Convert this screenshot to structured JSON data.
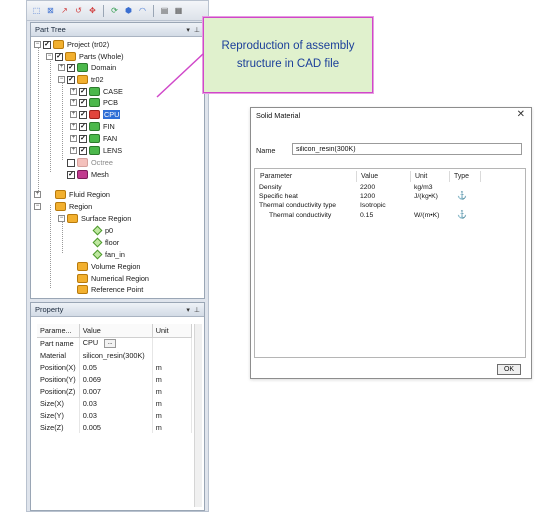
{
  "part_tree": {
    "title": "Part Tree",
    "items": [
      {
        "label": "Project (tr02)"
      },
      {
        "label": "Parts (Whole)"
      },
      {
        "label": "Domain"
      },
      {
        "label": "tr02"
      },
      {
        "label": "CASE"
      },
      {
        "label": "PCB"
      },
      {
        "label": "CPU"
      },
      {
        "label": "FIN"
      },
      {
        "label": "FAN"
      },
      {
        "label": "LENS"
      },
      {
        "label": "Octree"
      },
      {
        "label": "Mesh"
      },
      {
        "label": "Fluid Region"
      },
      {
        "label": "Region"
      },
      {
        "label": "Surface Region"
      },
      {
        "label": "p0"
      },
      {
        "label": "floor"
      },
      {
        "label": "fan_in"
      },
      {
        "label": "Volume Region"
      },
      {
        "label": "Numerical Region"
      },
      {
        "label": "Reference Point"
      }
    ]
  },
  "property": {
    "title": "Property",
    "headers": [
      "Parame...",
      "Value",
      "Unit"
    ],
    "rows": [
      {
        "param": "Part name",
        "value": "CPU",
        "unit": ""
      },
      {
        "param": "Material",
        "value": "silicon_resin(300K)",
        "unit": ""
      },
      {
        "param": "Position(X)",
        "value": "0.05",
        "unit": "m"
      },
      {
        "param": "Position(Y)",
        "value": "0.069",
        "unit": "m"
      },
      {
        "param": "Position(Z)",
        "value": "0.007",
        "unit": "m"
      },
      {
        "param": "Size(X)",
        "value": "0.03",
        "unit": "m"
      },
      {
        "param": "Size(Y)",
        "value": "0.03",
        "unit": "m"
      },
      {
        "param": "Size(Z)",
        "value": "0.005",
        "unit": "m"
      }
    ],
    "ellipsis": "..."
  },
  "callout": {
    "text": "Reproduction of assembly structure in CAD file"
  },
  "dialog": {
    "title": "Solid Material",
    "close": "✕",
    "name_label": "Name",
    "name_value": "silicon_resin(300K)",
    "headers": [
      "Parameter",
      "Value",
      "Unit",
      "Type"
    ],
    "rows": [
      {
        "param": "Density",
        "value": "2200",
        "unit": "kg/m3",
        "type": ""
      },
      {
        "param": "Specific heat",
        "value": "1200",
        "unit": "J/(kg•K)",
        "type": "anchor"
      },
      {
        "param": "Thermal conductivity type",
        "value": "Isotropic",
        "unit": "",
        "type": ""
      },
      {
        "param": "Thermal conductivity",
        "value": "0.15",
        "unit": "W/(m•K)",
        "type": "anchor"
      }
    ],
    "ok": "OK"
  },
  "colors": {
    "callout_border": "#d048c9",
    "callout_bg": "#e0f1cd",
    "callout_text": "#1b3f9a",
    "selection": "#2f6fd6"
  }
}
